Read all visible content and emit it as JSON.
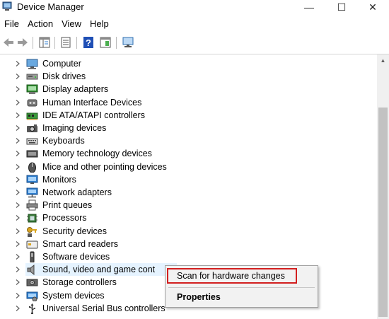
{
  "window": {
    "title": "Device Manager",
    "controls": {
      "minimize": "—",
      "maximize": "☐",
      "close": "✕"
    }
  },
  "menu": [
    "File",
    "Action",
    "View",
    "Help"
  ],
  "toolbar": {
    "buttons": [
      "back-arrow-icon",
      "forward-arrow-icon",
      "show-hide-console-tree-icon",
      "properties-icon",
      "help-icon",
      "action-pane-icon",
      "monitor-scan-icon"
    ]
  },
  "tree": {
    "items": [
      {
        "label": "Computer",
        "icon": "computer-icon"
      },
      {
        "label": "Disk drives",
        "icon": "disk-drive-icon"
      },
      {
        "label": "Display adapters",
        "icon": "display-adapter-icon"
      },
      {
        "label": "Human Interface Devices",
        "icon": "hid-icon"
      },
      {
        "label": "IDE ATA/ATAPI controllers",
        "icon": "ide-controller-icon"
      },
      {
        "label": "Imaging devices",
        "icon": "camera-icon"
      },
      {
        "label": "Keyboards",
        "icon": "keyboard-icon"
      },
      {
        "label": "Memory technology devices",
        "icon": "memory-icon"
      },
      {
        "label": "Mice and other pointing devices",
        "icon": "mouse-icon"
      },
      {
        "label": "Monitors",
        "icon": "monitor-icon"
      },
      {
        "label": "Network adapters",
        "icon": "network-adapter-icon"
      },
      {
        "label": "Print queues",
        "icon": "printer-icon"
      },
      {
        "label": "Processors",
        "icon": "processor-icon"
      },
      {
        "label": "Security devices",
        "icon": "security-key-icon"
      },
      {
        "label": "Smart card readers",
        "icon": "smart-card-icon"
      },
      {
        "label": "Software devices",
        "icon": "software-device-icon"
      },
      {
        "label": "Sound, video and game cont",
        "icon": "speaker-icon",
        "selected": true
      },
      {
        "label": "Storage controllers",
        "icon": "storage-controller-icon"
      },
      {
        "label": "System devices",
        "icon": "system-device-icon"
      },
      {
        "label": "Universal Serial Bus controllers",
        "icon": "usb-icon"
      }
    ]
  },
  "context_menu": {
    "items": [
      {
        "label": "Scan for hardware changes",
        "highlighted": true
      },
      {
        "label": "Properties",
        "bold": true
      }
    ]
  },
  "colors": {
    "selection": "#e5f3ff",
    "highlight_box": "#d21f1f"
  }
}
